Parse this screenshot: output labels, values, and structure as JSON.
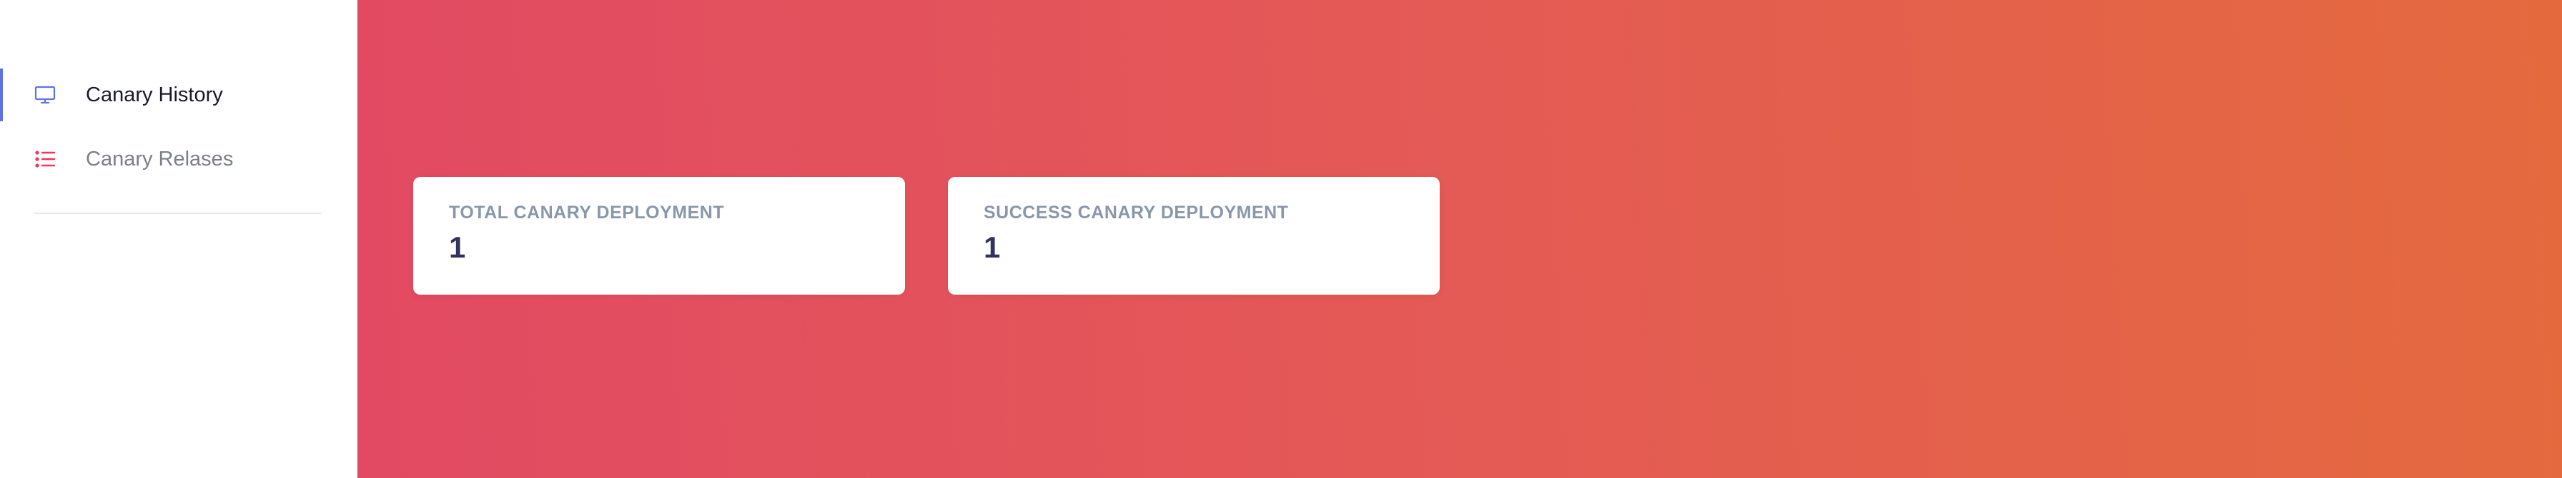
{
  "sidebar": {
    "items": [
      {
        "label": "Canary History",
        "icon": "monitor-icon",
        "active": true,
        "icon_color": "#5e72e4"
      },
      {
        "label": "Canary Relases",
        "icon": "list-icon",
        "active": false,
        "icon_color": "#f5365c"
      }
    ]
  },
  "main": {
    "gradient_start": "#e24a63",
    "gradient_end": "#e46a3e",
    "cards": [
      {
        "title": "TOTAL CANARY DEPLOYMENT",
        "value": "1"
      },
      {
        "title": "SUCCESS CANARY DEPLOYMENT",
        "value": "1"
      }
    ]
  }
}
